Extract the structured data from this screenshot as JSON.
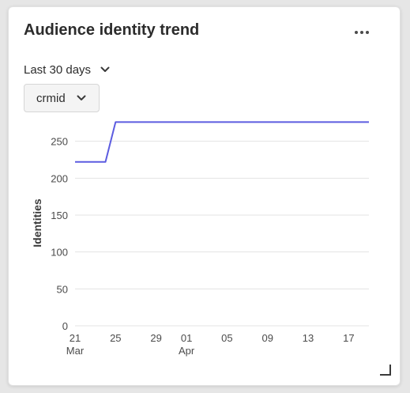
{
  "card": {
    "title": "Audience identity trend",
    "more_icon": "more-horizontal-icon",
    "resize_icon": "resize-corner-icon"
  },
  "filters": {
    "date_range": {
      "value": "Last 30 days",
      "icon": "chevron-down-icon"
    },
    "identity_namespace": {
      "value": "crmid",
      "icon": "chevron-down-icon"
    }
  },
  "colors": {
    "series": "#5c5ce0",
    "grid": "#e3e3e3",
    "axis_text": "#4b4b4b",
    "title": "#2c2c2c"
  },
  "chart_data": {
    "type": "line",
    "title": "",
    "xlabel": "",
    "ylabel": "Identities",
    "ylim": [
      0,
      300
    ],
    "yticks": [
      0,
      50,
      100,
      150,
      200,
      250
    ],
    "xlim": [
      "2024-03-21",
      "2024-04-19"
    ],
    "xticks": [
      {
        "date": "2024-03-21",
        "label": "21",
        "sublabel": "Mar"
      },
      {
        "date": "2024-03-25",
        "label": "25",
        "sublabel": ""
      },
      {
        "date": "2024-03-29",
        "label": "29",
        "sublabel": ""
      },
      {
        "date": "2024-04-01",
        "label": "01",
        "sublabel": "Apr"
      },
      {
        "date": "2024-04-05",
        "label": "05",
        "sublabel": ""
      },
      {
        "date": "2024-04-09",
        "label": "09",
        "sublabel": ""
      },
      {
        "date": "2024-04-13",
        "label": "13",
        "sublabel": ""
      },
      {
        "date": "2024-04-17",
        "label": "17",
        "sublabel": ""
      }
    ],
    "grid": true,
    "series": [
      {
        "points": [
          {
            "x": "2024-03-21",
            "y": 222
          },
          {
            "x": "2024-03-24",
            "y": 222
          },
          {
            "x": "2024-03-25",
            "y": 276
          },
          {
            "x": "2024-04-19",
            "y": 276
          }
        ]
      }
    ]
  }
}
